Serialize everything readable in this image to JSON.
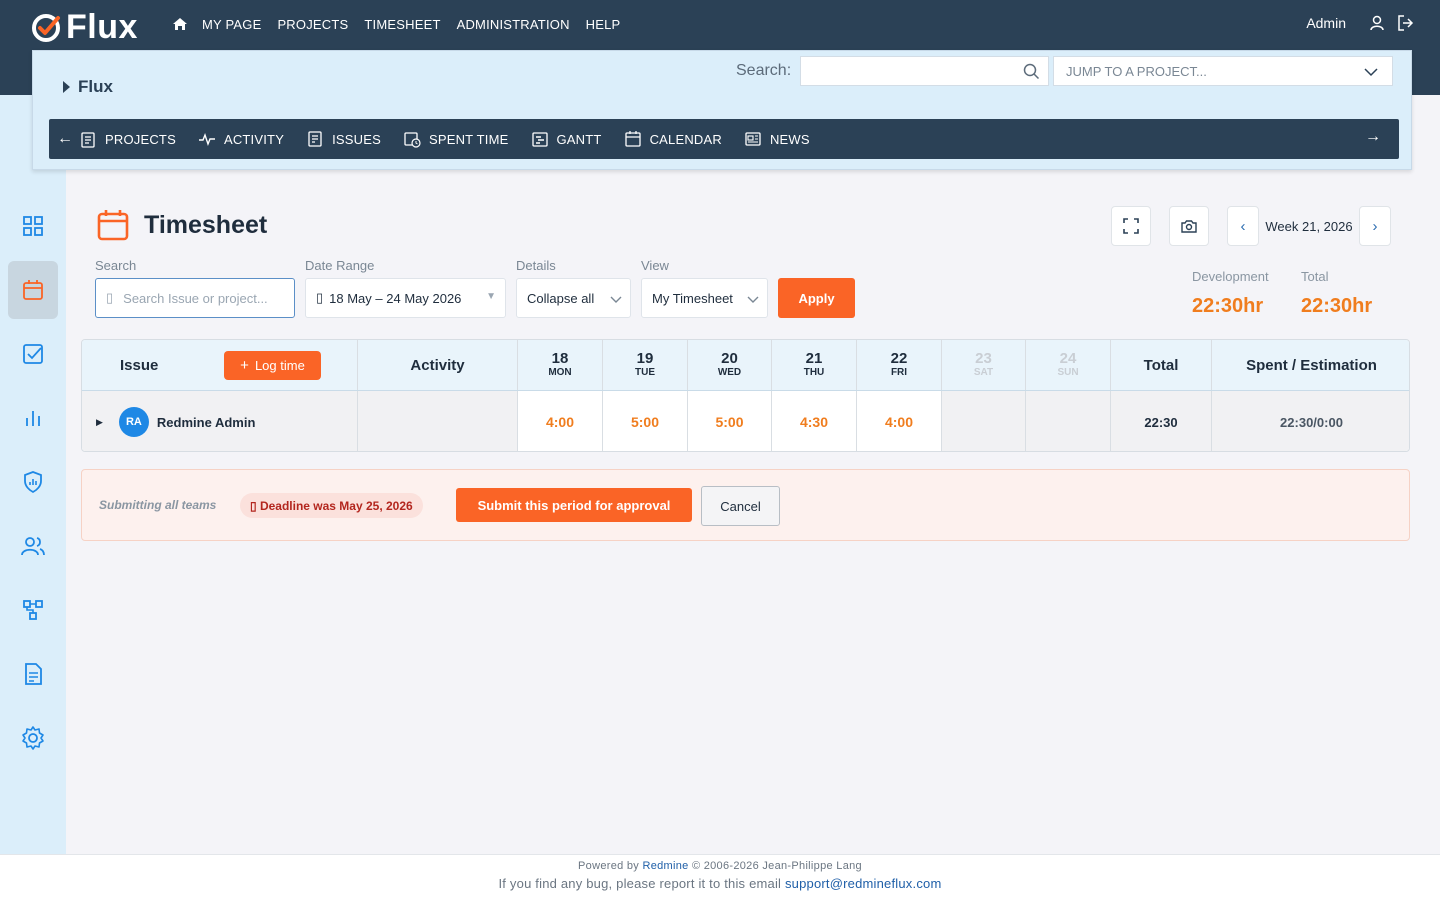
{
  "app": {
    "logo_text": "Flux"
  },
  "topnav": {
    "items": [
      "MY PAGE",
      "PROJECTS",
      "TIMESHEET",
      "ADMINISTRATION",
      "HELP"
    ]
  },
  "user": {
    "name": "Admin"
  },
  "project": {
    "name": "Flux",
    "search_label": "Search:",
    "search_value": "",
    "jump_placeholder": "JUMP TO A PROJECT...",
    "menu": [
      "PROJECTS",
      "ACTIVITY",
      "ISSUES",
      "SPENT TIME",
      "GANTT",
      "CALENDAR",
      "NEWS"
    ]
  },
  "page": {
    "title": "Timesheet",
    "week_label": "Week 21, 2026"
  },
  "filters": {
    "search_label": "Search",
    "search_placeholder": "Search Issue or project...",
    "date_label": "Date Range",
    "date_icon": "▯",
    "date_value": "18 May – 24 May 2026",
    "details_label": "Details",
    "details_value": "Collapse all",
    "view_label": "View",
    "view_value": "My Timesheet",
    "apply_label": "Apply"
  },
  "summary": {
    "dev_label": "Development",
    "dev_value": "22:30hr",
    "total_label": "Total",
    "total_value": "22:30hr"
  },
  "table": {
    "issue_header": "Issue",
    "log_time_label": "Log time",
    "activity_header": "Activity",
    "days": [
      {
        "num": "18",
        "name": "MON"
      },
      {
        "num": "19",
        "name": "TUE"
      },
      {
        "num": "20",
        "name": "WED"
      },
      {
        "num": "21",
        "name": "THU"
      },
      {
        "num": "22",
        "name": "FRI"
      },
      {
        "num": "23",
        "name": "SAT"
      },
      {
        "num": "24",
        "name": "SUN"
      }
    ],
    "total_header": "Total",
    "spent_header": "Spent / Estimation",
    "row": {
      "initials": "RA",
      "name": "Redmine Admin",
      "hours": [
        "4:00",
        "5:00",
        "5:00",
        "4:30",
        "4:00",
        "",
        ""
      ],
      "total": "22:30",
      "spent": "22:30/0:00"
    }
  },
  "approval": {
    "note": "Submitting all teams",
    "deadline": "▯ Deadline was May 25, 2026",
    "submit_label": "Submit this period for approval",
    "cancel_label": "Cancel"
  },
  "footer": {
    "line1_prefix": "Powered by ",
    "line1_link": "Redmine",
    "line1_suffix": " © 2006-2026 Jean-Philippe Lang",
    "line2_prefix": "If you find any bug, please report it to this email ",
    "line2_link": "support@redmineflux.com"
  },
  "colors": {
    "brand_dark": "#2b4156",
    "accent": "#fa6426",
    "light_blue": "#dbeefa",
    "hours": "#f07d1e"
  },
  "icons": [
    "home-icon",
    "user-icon",
    "logout-icon",
    "search-icon",
    "chevron-down-icon",
    "dashboard-icon",
    "calendar-icon",
    "checkbox-icon",
    "chart-icon",
    "shield-icon",
    "users-icon",
    "workflow-icon",
    "document-icon",
    "gear-icon",
    "fullscreen-icon",
    "camera-icon"
  ]
}
